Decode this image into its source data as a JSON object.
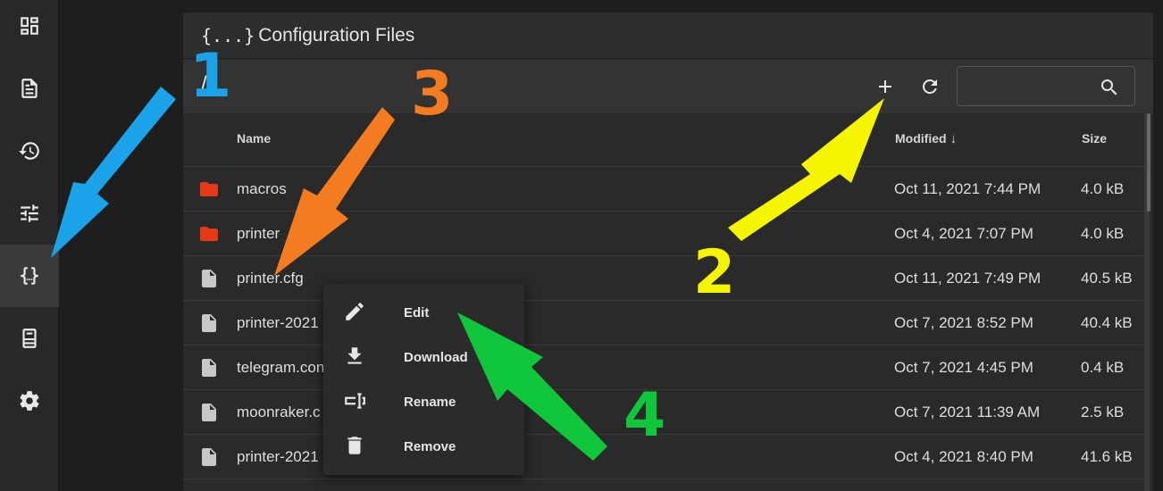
{
  "sidebar": {
    "items": [
      {
        "name": "dashboard"
      },
      {
        "name": "console"
      },
      {
        "name": "history"
      },
      {
        "name": "tune"
      },
      {
        "name": "configuration",
        "active": true
      },
      {
        "name": "machine"
      },
      {
        "name": "settings"
      }
    ]
  },
  "card": {
    "icon": "{...}",
    "title": "Configuration Files"
  },
  "toolbar": {
    "path": "/",
    "search": {
      "value": "",
      "placeholder": ""
    }
  },
  "table": {
    "headers": {
      "name": "Name",
      "modified": "Modified",
      "size": "Size"
    },
    "rows": [
      {
        "type": "folder",
        "name": "macros",
        "modified": "Oct 11, 2021 7:44 PM",
        "size": "4.0 kB"
      },
      {
        "type": "folder",
        "name": "printer",
        "modified": "Oct 4, 2021 7:07 PM",
        "size": "4.0 kB"
      },
      {
        "type": "file",
        "name": "printer.cfg",
        "modified": "Oct 11, 2021 7:49 PM",
        "size": "40.5 kB"
      },
      {
        "type": "file",
        "name": "printer-2021",
        "modified": "Oct 7, 2021 8:52 PM",
        "size": "40.4 kB"
      },
      {
        "type": "file",
        "name": "telegram.con",
        "modified": "Oct 7, 2021 4:45 PM",
        "size": "0.4 kB"
      },
      {
        "type": "file",
        "name": "moonraker.c",
        "modified": "Oct 7, 2021 11:39 AM",
        "size": "2.5 kB"
      },
      {
        "type": "file",
        "name": "printer-2021",
        "modified": "Oct 4, 2021 8:40 PM",
        "size": "41.6 kB"
      }
    ]
  },
  "context_menu": {
    "items": [
      {
        "label": "Edit",
        "icon": "pencil-icon"
      },
      {
        "label": "Download",
        "icon": "download-icon"
      },
      {
        "label": "Rename",
        "icon": "rename-icon"
      },
      {
        "label": "Remove",
        "icon": "trash-icon"
      }
    ]
  },
  "annotations": {
    "n1": "1",
    "n2": "2",
    "n3": "3",
    "n4": "4",
    "colors": {
      "blue": "#1aa3e8",
      "yellow": "#f5f500",
      "orange": "#f47c20",
      "green": "#10c63b"
    }
  },
  "colors": {
    "folder": "#e53918",
    "file": "#c8c8c8"
  }
}
